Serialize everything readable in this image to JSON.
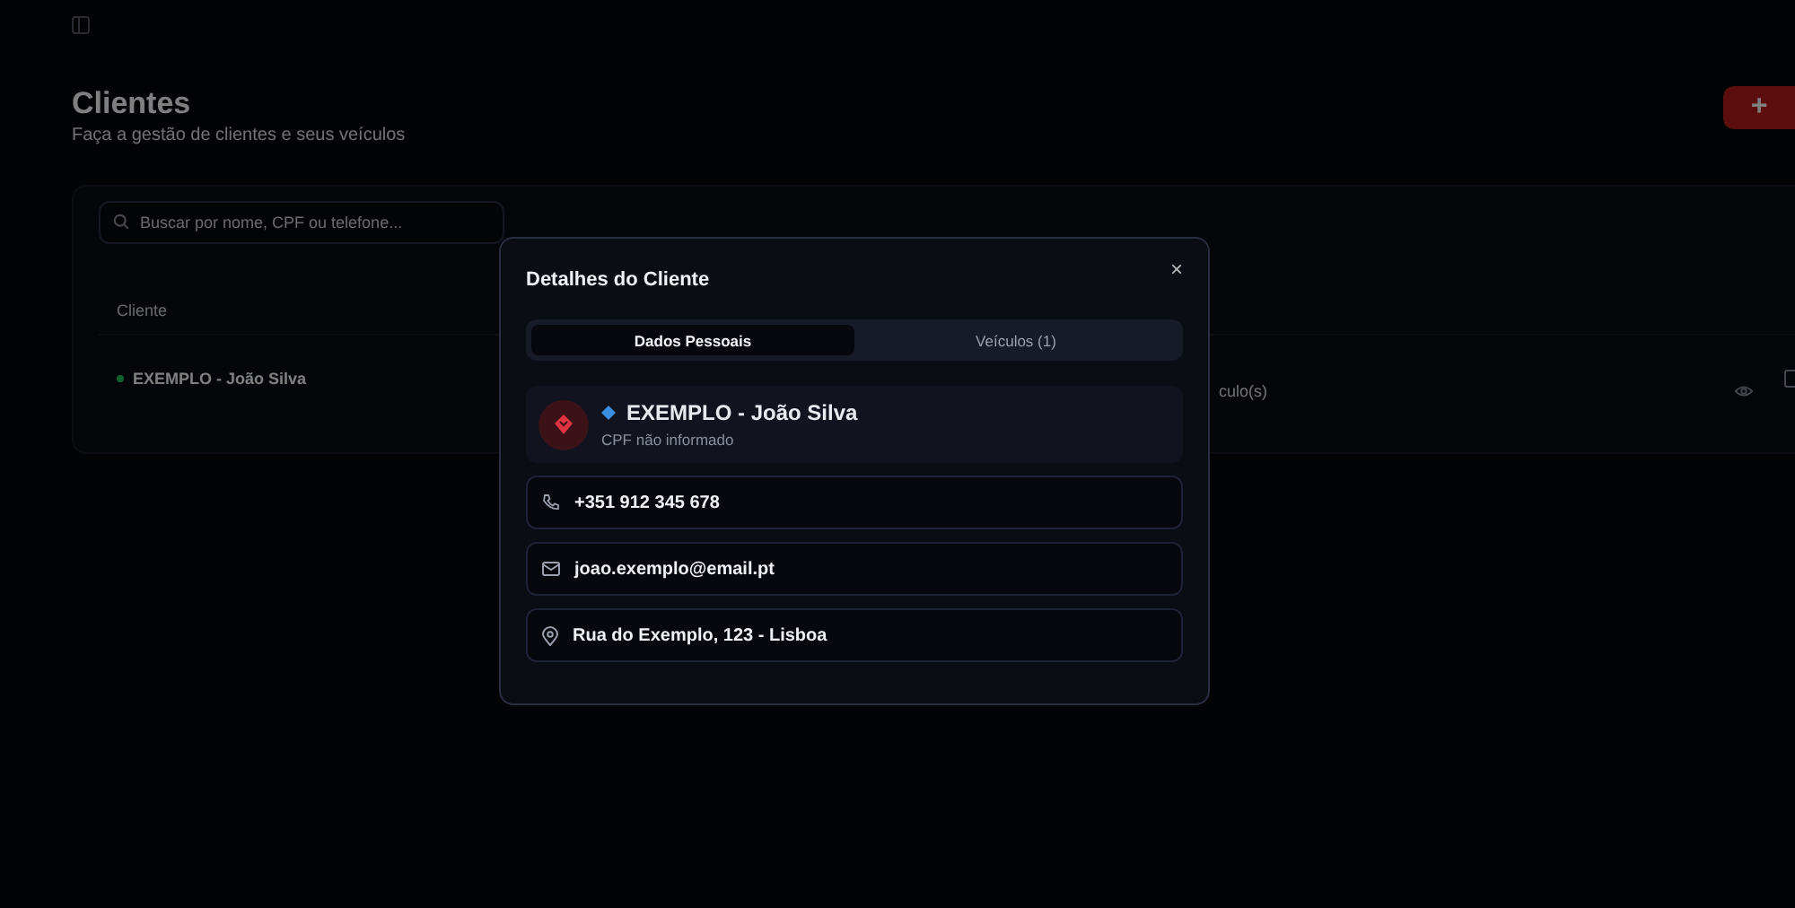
{
  "page": {
    "title": "Clientes",
    "subtitle": "Faça a gestão de clientes e seus veículos",
    "add_button": "+"
  },
  "search": {
    "placeholder": "Buscar por nome, CPF ou telefone..."
  },
  "table": {
    "columns": [
      "Cliente"
    ],
    "rows": [
      {
        "name": "EXEMPLO - João Silva",
        "vehicles": "culo(s)"
      }
    ]
  },
  "modal": {
    "title": "Detalhes do Cliente",
    "close": "×",
    "tabs": [
      {
        "label": "Dados Pessoais",
        "selected": true
      },
      {
        "label": "Veículos (1)",
        "selected": false
      }
    ],
    "client": {
      "name": "EXEMPLO - João Silva",
      "cpf": "CPF não informado"
    },
    "fields": [
      {
        "kind": "phone",
        "value": "+351 912 345 678"
      },
      {
        "kind": "email",
        "value": "joao.exemplo@email.pt"
      },
      {
        "kind": "address",
        "value": "Rua do Exemplo, 123 - Lisboa"
      }
    ]
  }
}
